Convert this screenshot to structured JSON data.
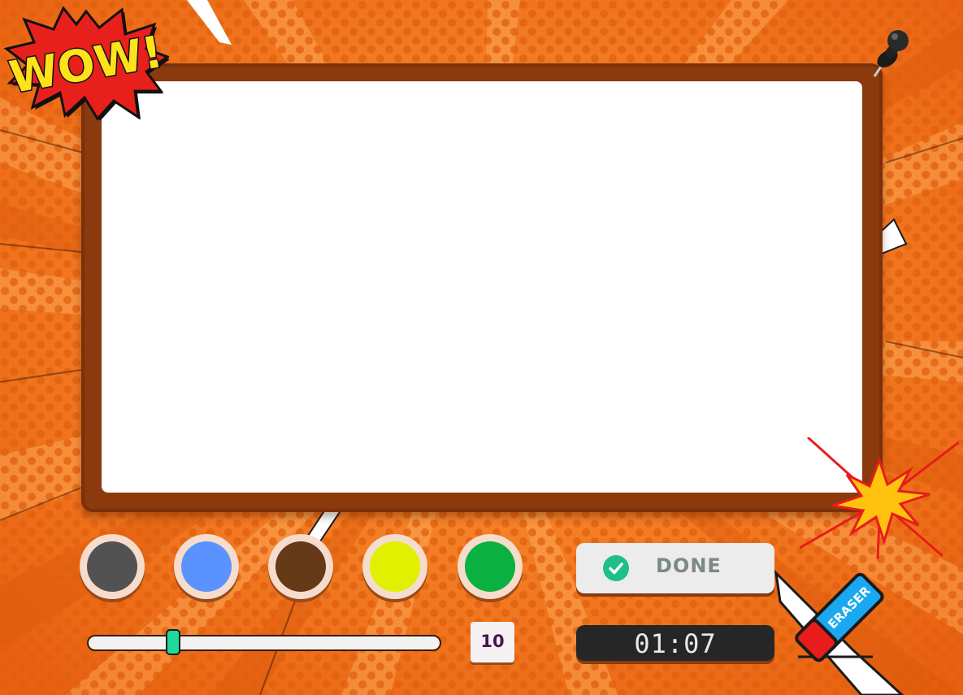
{
  "badges": {
    "wow_text": "WOW!"
  },
  "palette": {
    "colors": [
      {
        "name": "dark-gray",
        "hex": "#525252"
      },
      {
        "name": "blue",
        "hex": "#5a93ff"
      },
      {
        "name": "brown",
        "hex": "#643a18"
      },
      {
        "name": "yellow",
        "hex": "#e0f000"
      },
      {
        "name": "green",
        "hex": "#0ab040"
      }
    ]
  },
  "done_button": {
    "label": "DONE",
    "icon": "check-circle-icon"
  },
  "brush": {
    "size": "10",
    "level": 0.23
  },
  "timer": {
    "value": "01:07"
  },
  "eraser": {
    "label": "ERASER"
  },
  "colors": {
    "background": "#f07418",
    "board_frame": "#8a3a0c",
    "canvas": "#ffffff",
    "accent_green": "#1ed89c"
  }
}
